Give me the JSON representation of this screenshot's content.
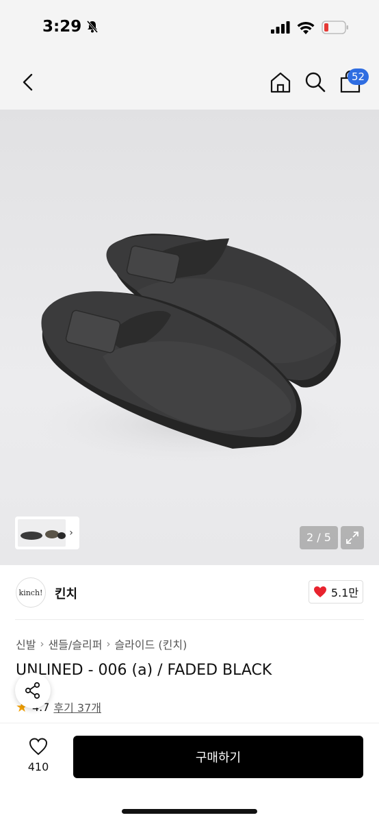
{
  "status": {
    "time": "3:29"
  },
  "nav": {
    "bag_count": "52"
  },
  "gallery": {
    "pager": "2 / 5"
  },
  "brand": {
    "logo_text": "kinch!",
    "name": "킨치",
    "likes": "5.1만"
  },
  "breadcrumb": [
    "신발",
    "샌들/슬리퍼",
    "슬라이드 (킨치)"
  ],
  "product": {
    "title": "UNLINED - 006 (a) / FADED BLACK",
    "rating": "4.7",
    "reviews": "후기 37개"
  },
  "bottom": {
    "wish_count": "410",
    "buy_label": "구매하기"
  },
  "colors": {
    "accent_badge": "#2f6de1",
    "heart": "#e8232e",
    "star": "#f4a100",
    "buy_button": "#000000"
  },
  "icons": [
    "back-chevron-icon",
    "home-icon",
    "search-icon",
    "shopping-bag-icon",
    "heart-icon",
    "star-icon",
    "share-icon",
    "expand-icon",
    "bell-slash-icon",
    "signal-icon",
    "wifi-icon",
    "battery-icon"
  ]
}
